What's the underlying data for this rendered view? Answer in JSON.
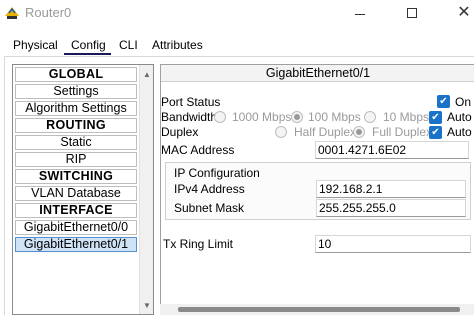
{
  "window": {
    "title": "Router0",
    "icon": "router-app-icon"
  },
  "tabs": [
    {
      "label": "Physical"
    },
    {
      "label": "Config",
      "active": true
    },
    {
      "label": "CLI"
    },
    {
      "label": "Attributes"
    }
  ],
  "nav": {
    "items": [
      {
        "label": "GLOBAL",
        "type": "section"
      },
      {
        "label": "Settings"
      },
      {
        "label": "Algorithm Settings"
      },
      {
        "label": "ROUTING",
        "type": "section"
      },
      {
        "label": "Static"
      },
      {
        "label": "RIP"
      },
      {
        "label": "SWITCHING",
        "type": "section"
      },
      {
        "label": "VLAN Database"
      },
      {
        "label": "INTERFACE",
        "type": "section"
      },
      {
        "label": "GigabitEthernet0/0"
      },
      {
        "label": "GigabitEthernet0/1",
        "selected": true
      }
    ]
  },
  "interface": {
    "title": "GigabitEthernet0/1",
    "port_status_label": "Port Status",
    "port_status_on_label": "On",
    "port_status_on": true,
    "bandwidth_label": "Bandwidth",
    "bandwidth_options": [
      "1000 Mbps",
      "100 Mbps",
      "10 Mbps"
    ],
    "bandwidth_selected": "100 Mbps",
    "bandwidth_auto_label": "Auto",
    "bandwidth_auto": true,
    "duplex_label": "Duplex",
    "duplex_options": [
      "Half Duplex",
      "Full Duplex"
    ],
    "duplex_selected": "Full Duplex",
    "duplex_auto_label": "Auto",
    "duplex_auto": true,
    "mac_label": "MAC Address",
    "mac_value": "0001.4271.6E02",
    "ip_config_label": "IP Configuration",
    "ipv4_label": "IPv4 Address",
    "ipv4_value": "192.168.2.1",
    "subnet_label": "Subnet Mask",
    "subnet_value": "255.255.255.0",
    "tx_ring_label": "Tx Ring Limit",
    "tx_ring_value": "10"
  },
  "colors": {
    "accent": "#1a73c9",
    "selected_bg": "#cfe3f7"
  }
}
